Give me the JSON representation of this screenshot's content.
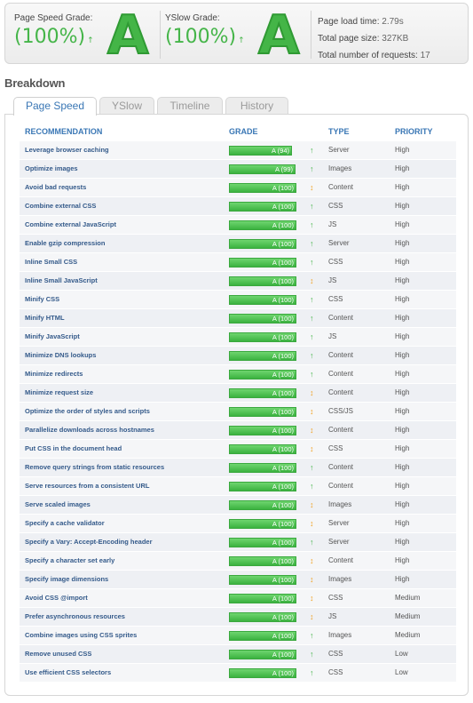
{
  "summary": {
    "page_speed": {
      "label": "Page Speed Grade:",
      "percent": "(100%)",
      "arrow": "↑",
      "letter": "A"
    },
    "yslow": {
      "label": "YSlow Grade:",
      "percent": "(100%)",
      "arrow": "↑",
      "letter": "A"
    },
    "stats": [
      {
        "label": "Page load time:",
        "value": "2.79s"
      },
      {
        "label": "Total page size:",
        "value": "327KB"
      },
      {
        "label": "Total number of requests:",
        "value": "17"
      }
    ]
  },
  "breakdown_title": "Breakdown",
  "tabs": [
    "Page Speed",
    "YSlow",
    "Timeline",
    "History"
  ],
  "columns": {
    "recommendation": "RECOMMENDATION",
    "grade": "GRADE",
    "type": "TYPE",
    "priority": "PRIORITY"
  },
  "colors": {
    "accent_blue": "#3a77b5",
    "grade_green": "#45b549",
    "trend_orange": "#f0a020"
  },
  "rows": [
    {
      "rec": "Leverage browser caching",
      "grade": "A (94)",
      "score": 94,
      "trend": "up",
      "type": "Server",
      "priority": "High"
    },
    {
      "rec": "Optimize images",
      "grade": "A (99)",
      "score": 99,
      "trend": "up",
      "type": "Images",
      "priority": "High"
    },
    {
      "rec": "Avoid bad requests",
      "grade": "A (100)",
      "score": 100,
      "trend": "mixed",
      "type": "Content",
      "priority": "High"
    },
    {
      "rec": "Combine external CSS",
      "grade": "A (100)",
      "score": 100,
      "trend": "up",
      "type": "CSS",
      "priority": "High"
    },
    {
      "rec": "Combine external JavaScript",
      "grade": "A (100)",
      "score": 100,
      "trend": "up",
      "type": "JS",
      "priority": "High"
    },
    {
      "rec": "Enable gzip compression",
      "grade": "A (100)",
      "score": 100,
      "trend": "up",
      "type": "Server",
      "priority": "High"
    },
    {
      "rec": "Inline Small CSS",
      "grade": "A (100)",
      "score": 100,
      "trend": "up",
      "type": "CSS",
      "priority": "High"
    },
    {
      "rec": "Inline Small JavaScript",
      "grade": "A (100)",
      "score": 100,
      "trend": "mixed",
      "type": "JS",
      "priority": "High"
    },
    {
      "rec": "Minify CSS",
      "grade": "A (100)",
      "score": 100,
      "trend": "up",
      "type": "CSS",
      "priority": "High"
    },
    {
      "rec": "Minify HTML",
      "grade": "A (100)",
      "score": 100,
      "trend": "up",
      "type": "Content",
      "priority": "High"
    },
    {
      "rec": "Minify JavaScript",
      "grade": "A (100)",
      "score": 100,
      "trend": "up",
      "type": "JS",
      "priority": "High"
    },
    {
      "rec": "Minimize DNS lookups",
      "grade": "A (100)",
      "score": 100,
      "trend": "up",
      "type": "Content",
      "priority": "High"
    },
    {
      "rec": "Minimize redirects",
      "grade": "A (100)",
      "score": 100,
      "trend": "up",
      "type": "Content",
      "priority": "High"
    },
    {
      "rec": "Minimize request size",
      "grade": "A (100)",
      "score": 100,
      "trend": "mixed",
      "type": "Content",
      "priority": "High"
    },
    {
      "rec": "Optimize the order of styles and scripts",
      "grade": "A (100)",
      "score": 100,
      "trend": "mixed",
      "type": "CSS/JS",
      "priority": "High"
    },
    {
      "rec": "Parallelize downloads across hostnames",
      "grade": "A (100)",
      "score": 100,
      "trend": "mixed",
      "type": "Content",
      "priority": "High"
    },
    {
      "rec": "Put CSS in the document head",
      "grade": "A (100)",
      "score": 100,
      "trend": "mixed",
      "type": "CSS",
      "priority": "High"
    },
    {
      "rec": "Remove query strings from static resources",
      "grade": "A (100)",
      "score": 100,
      "trend": "up",
      "type": "Content",
      "priority": "High"
    },
    {
      "rec": "Serve resources from a consistent URL",
      "grade": "A (100)",
      "score": 100,
      "trend": "up",
      "type": "Content",
      "priority": "High"
    },
    {
      "rec": "Serve scaled images",
      "grade": "A (100)",
      "score": 100,
      "trend": "mixed",
      "type": "Images",
      "priority": "High"
    },
    {
      "rec": "Specify a cache validator",
      "grade": "A (100)",
      "score": 100,
      "trend": "mixed",
      "type": "Server",
      "priority": "High"
    },
    {
      "rec": "Specify a Vary: Accept-Encoding header",
      "grade": "A (100)",
      "score": 100,
      "trend": "up",
      "type": "Server",
      "priority": "High"
    },
    {
      "rec": "Specify a character set early",
      "grade": "A (100)",
      "score": 100,
      "trend": "mixed",
      "type": "Content",
      "priority": "High"
    },
    {
      "rec": "Specify image dimensions",
      "grade": "A (100)",
      "score": 100,
      "trend": "mixed",
      "type": "Images",
      "priority": "High"
    },
    {
      "rec": "Avoid CSS @import",
      "grade": "A (100)",
      "score": 100,
      "trend": "mixed",
      "type": "CSS",
      "priority": "Medium"
    },
    {
      "rec": "Prefer asynchronous resources",
      "grade": "A (100)",
      "score": 100,
      "trend": "mixed",
      "type": "JS",
      "priority": "Medium"
    },
    {
      "rec": "Combine images using CSS sprites",
      "grade": "A (100)",
      "score": 100,
      "trend": "up",
      "type": "Images",
      "priority": "Medium"
    },
    {
      "rec": "Remove unused CSS",
      "grade": "A (100)",
      "score": 100,
      "trend": "up",
      "type": "CSS",
      "priority": "Low"
    },
    {
      "rec": "Use efficient CSS selectors",
      "grade": "A (100)",
      "score": 100,
      "trend": "up",
      "type": "CSS",
      "priority": "Low"
    }
  ]
}
